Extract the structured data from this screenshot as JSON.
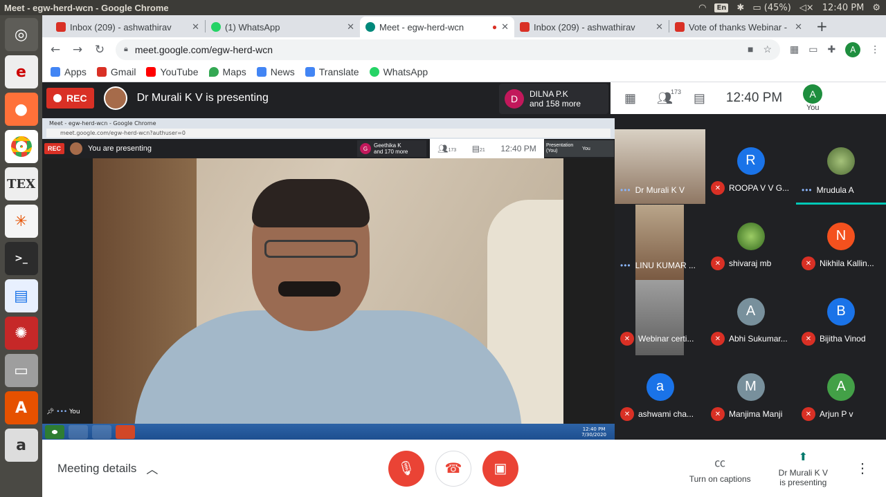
{
  "os_bar": {
    "window_title": "Meet - egw-herd-wcn - Google Chrome",
    "lang": "En",
    "battery": "(45%)",
    "time": "12:40 PM"
  },
  "launcher": {
    "items": [
      "ubuntu-dash",
      "evince",
      "firefox",
      "chrome",
      "texmaker",
      "app-2",
      "terminal",
      "writer",
      "app-3",
      "files",
      "software",
      "amazon"
    ]
  },
  "tabs": [
    {
      "label": "Inbox (209) - ashwathirav",
      "icon": "gmail-icon",
      "color": "#d93025"
    },
    {
      "label": "(1) WhatsApp",
      "icon": "whatsapp-icon",
      "color": "#25d366"
    },
    {
      "label": "Meet - egw-herd-wcn",
      "icon": "meet-icon",
      "color": "#00897b"
    },
    {
      "label": "Inbox (209) - ashwathirav",
      "icon": "gmail-icon",
      "color": "#d93025"
    },
    {
      "label": "Vote of thanks Webinar -",
      "icon": "gmail-icon",
      "color": "#d93025"
    }
  ],
  "address": {
    "url": "meet.google.com/egw-herd-wcn",
    "profile": "A"
  },
  "bookmarks": [
    {
      "label": "Apps",
      "color": "#4285f4"
    },
    {
      "label": "Gmail",
      "color": "#d93025"
    },
    {
      "label": "YouTube",
      "color": "#ff0000"
    },
    {
      "label": "Maps",
      "color": "#34a853"
    },
    {
      "label": "News",
      "color": "#4285f4"
    },
    {
      "label": "Translate",
      "color": "#4285f4"
    },
    {
      "label": "WhatsApp",
      "color": "#25d366"
    }
  ],
  "meet": {
    "rec_label": "REC",
    "presenting": "Dr Murali K V is presenting",
    "speaker": {
      "initial": "D",
      "name": "DILNA P.K",
      "more": "and 158 more"
    },
    "people_count": "173",
    "time": "12:40  PM",
    "you_label": "You",
    "you_initial": "A"
  },
  "shared_screen": {
    "window_title": "Meet - egw-herd-wcn - Google Chrome",
    "url": "meet.google.com/egw-herd-wcn?authuser=0",
    "rec_label": "REC",
    "presenting": "You are presenting",
    "speaker_initial": "G",
    "speaker_name": "Geethika K",
    "speaker_more": "and 170 more",
    "people_count": "173",
    "chat_count": "21",
    "time": "12:40  PM",
    "presentation_label": "Presentation (You)",
    "you_label": "You",
    "you_tag": "You",
    "taskbar_time": "12:40 PM",
    "taskbar_date": "7/30/2020"
  },
  "participants": [
    {
      "name": "Dr Murali K V",
      "type": "photo",
      "speaking": true
    },
    {
      "name": "ROOPA V V G...",
      "initial": "R",
      "color": "#1a73e8",
      "muted": true
    },
    {
      "name": "Mrudula A",
      "initial": "",
      "color": "#6d8f4f",
      "speaking": true,
      "active": true
    },
    {
      "name": "LINU KUMAR ...",
      "type": "photo",
      "speaking": true
    },
    {
      "name": "shivaraj mb",
      "initial": "",
      "color": "#5fa84a",
      "muted": true
    },
    {
      "name": "Nikhila Kallin...",
      "initial": "N",
      "color": "#f4511e",
      "muted": true
    },
    {
      "name": "Webinar certi...",
      "type": "photo",
      "muted": true
    },
    {
      "name": "Abhi Sukumar...",
      "initial": "A",
      "color": "#78909c",
      "muted": true
    },
    {
      "name": "Bijitha Vinod",
      "initial": "B",
      "color": "#1a73e8",
      "muted": true
    },
    {
      "name": "ashwami cha...",
      "initial": "a",
      "color": "#1a73e8",
      "muted": true
    },
    {
      "name": "Manjima Manji",
      "initial": "M",
      "color": "#78909c",
      "muted": true
    },
    {
      "name": "Arjun P v",
      "initial": "A",
      "color": "#43a047",
      "muted": true
    }
  ],
  "bottom": {
    "details": "Meeting details",
    "captions": "Turn on captions",
    "presenting_line1": "Dr Murali K V",
    "presenting_line2": "is presenting"
  }
}
